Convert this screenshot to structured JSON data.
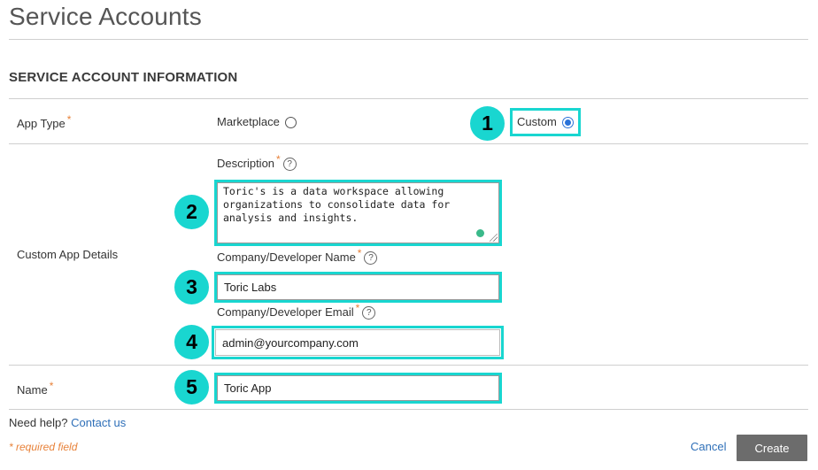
{
  "page": {
    "title": "Service Accounts",
    "section_heading": "SERVICE ACCOUNT INFORMATION",
    "required_marker": "*"
  },
  "app_type": {
    "label": "App Type",
    "options": [
      {
        "label": "Marketplace",
        "selected": false
      },
      {
        "label": "Custom",
        "selected": true
      }
    ]
  },
  "custom_app_details": {
    "label": "Custom App Details",
    "description": {
      "label": "Description",
      "value": "Toric's is a data workspace allowing\norganizations to consolidate data for\nanalysis and insights."
    },
    "company_name": {
      "label": "Company/Developer Name",
      "value": "Toric Labs"
    },
    "company_email": {
      "label": "Company/Developer Email",
      "value": "admin@yourcompany.com"
    }
  },
  "name_field": {
    "label": "Name",
    "value": "Toric App"
  },
  "help_icon_glyph": "?",
  "footer": {
    "need_help": "Need help?",
    "contact_link": "Contact us",
    "required_note": "* required field",
    "cancel_label": "Cancel",
    "create_label": "Create"
  },
  "callouts": [
    "1",
    "2",
    "3",
    "4",
    "5"
  ],
  "colors": {
    "highlight": "#19d6d0",
    "link": "#2e6fb8",
    "required": "#e8823a",
    "radio_selected": "#2a72d8",
    "create_button": "#6c6c6c"
  }
}
